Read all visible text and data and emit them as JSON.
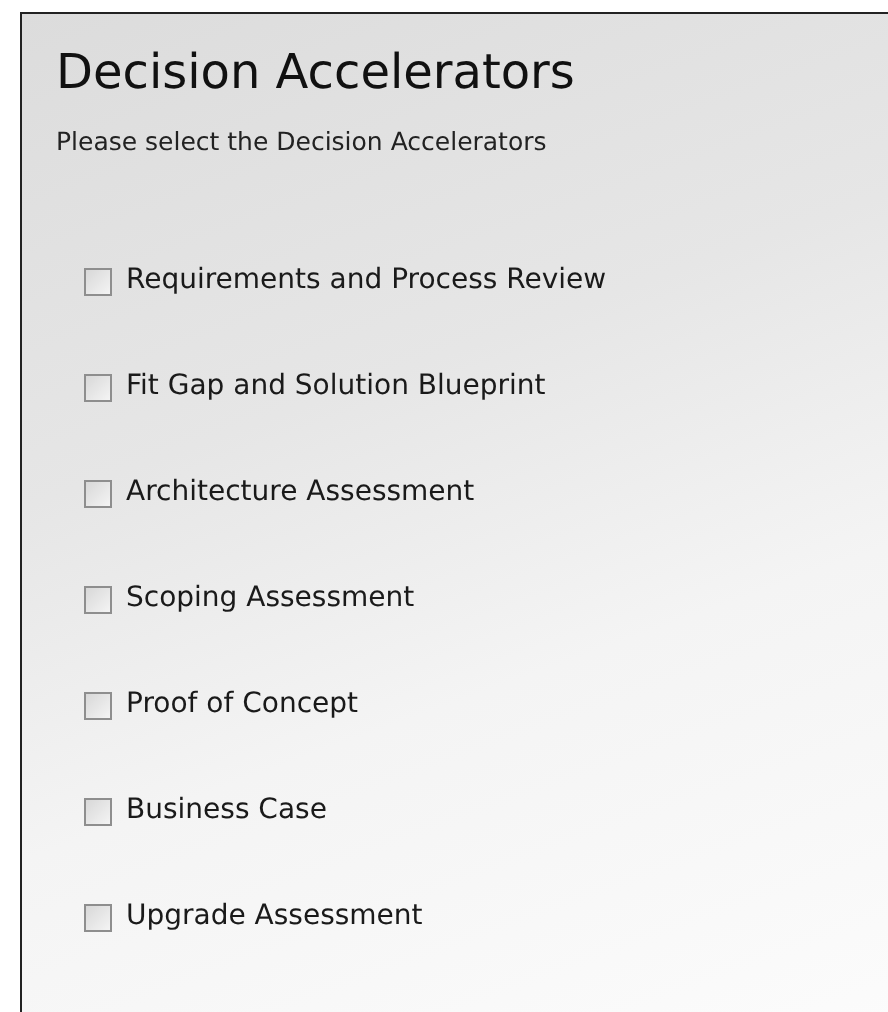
{
  "title": "Decision Accelerators",
  "instruction": "Please select the Decision Accelerators",
  "options": [
    {
      "label": "Requirements and Process Review",
      "checked": false
    },
    {
      "label": "Fit Gap and Solution Blueprint",
      "checked": false
    },
    {
      "label": "Architecture Assessment",
      "checked": false
    },
    {
      "label": "Scoping Assessment",
      "checked": false
    },
    {
      "label": "Proof of Concept",
      "checked": false
    },
    {
      "label": "Business Case",
      "checked": false
    },
    {
      "label": "Upgrade Assessment",
      "checked": false
    }
  ]
}
